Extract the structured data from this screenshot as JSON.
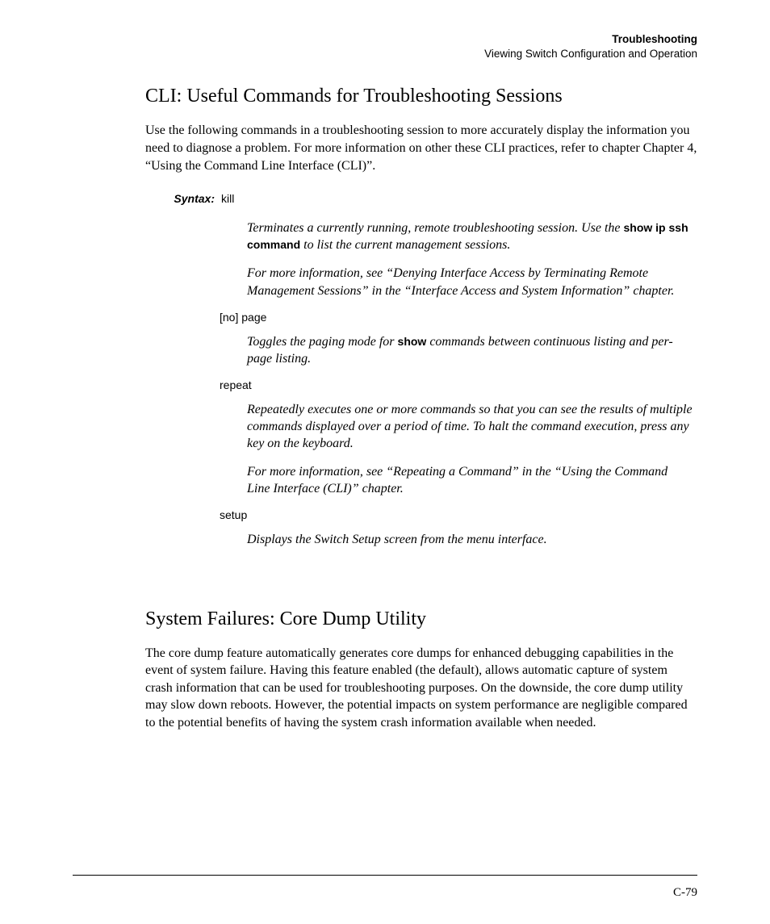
{
  "header": {
    "bold": "Troubleshooting",
    "sub": "Viewing Switch Configuration and Operation"
  },
  "section1": {
    "title": "CLI: Useful Commands for Troubleshooting Sessions",
    "intro": "Use the following commands in a troubleshooting session to more accurately display the information you need to diagnose a problem. For more information on other these CLI practices, refer to chapter Chapter 4, “Using the Command Line Interface (CLI)”."
  },
  "syntax": {
    "label": "Syntax:",
    "cmd_kill": "kill",
    "kill_desc1_a": "Terminates a currently running, remote troubleshooting session. Use the ",
    "kill_desc1_bold": "show ip ssh command",
    "kill_desc1_b": " to list the current management sessions.",
    "kill_desc2": "For more information, see “Denying Interface Access by Terminating Remote Management Sessions” in the “Interface Access and System Information” chapter.",
    "cmd_page": "[no] page",
    "page_desc_a": "Toggles the paging mode for ",
    "page_desc_bold": "show",
    "page_desc_b": " commands between continuous listing and per-page listing.",
    "cmd_repeat": "repeat",
    "repeat_desc1": "Repeatedly executes one or more commands so that you can see the results of multiple commands displayed over a period of time. To halt the command execution, press any key on the keyboard.",
    "repeat_desc2": "For more information, see “Repeating a Command” in the “Using the Command Line Interface (CLI)” chapter.",
    "cmd_setup": "setup",
    "setup_desc": "Displays the Switch Setup screen from the menu interface."
  },
  "section2": {
    "title": "System Failures: Core Dump Utility",
    "body": "The core dump feature automatically generates core dumps for enhanced debugging capabilities in the event of system failure. Having this feature enabled (the default), allows automatic capture of system crash information that can be used for troubleshooting purposes. On the downside, the core dump utility may slow down reboots. However, the potential impacts on system performance are negligible compared to the potential benefits of having the system crash information available when needed."
  },
  "page_number": "C-79"
}
